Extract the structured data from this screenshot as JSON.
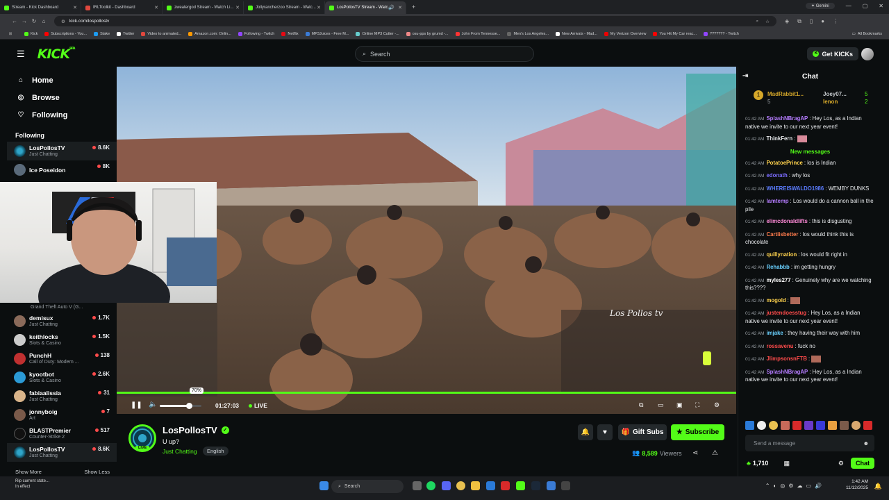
{
  "browser": {
    "tabs": [
      {
        "title": "Stream - Kick Dashboard",
        "active": false
      },
      {
        "title": "IRLToolkit - Dashboard",
        "active": false
      },
      {
        "title": "zweatergod Stream - Watch Li...",
        "active": false
      },
      {
        "title": "Jollyrancherzoo Stream - Watc...",
        "active": false
      },
      {
        "title": "LosPollosTV Stream - Watc...",
        "active": true
      }
    ],
    "gemini_label": "Gemini",
    "url": "kick.com/lospollostv",
    "bookmarks": [
      "Kick",
      "Subscriptions - You...",
      "Stake",
      "Twitter",
      "Video to animated...",
      "Amazon.com: Onlin...",
      "Following - Twitch",
      "Netflix",
      "MP3Juices - Free M...",
      "Online MP3 Cutter -...",
      "osu-pps by grumd -...",
      "John From Tennesse...",
      "Men's Los Angeles...",
      "New Arrivals - Mad...",
      "My Verizon Overview",
      "You Hit My Car reac...",
      "??????? - Twitch"
    ],
    "all_bookmarks": "All Bookmarks"
  },
  "header": {
    "logo": "KICK",
    "logo_badge": "BETA",
    "search_placeholder": "Search",
    "get_kicks": "Get KICKs"
  },
  "sidebar": {
    "nav": [
      {
        "label": "Home",
        "icon": "home-icon"
      },
      {
        "label": "Browse",
        "icon": "compass-icon"
      },
      {
        "label": "Following",
        "icon": "heart-icon"
      }
    ],
    "following_heading": "Following",
    "channels_top": [
      {
        "name": "LosPollosTV",
        "category": "Just Chatting",
        "viewers": "8.6K",
        "selected": true
      },
      {
        "name": "Ice Poseidon",
        "category": "",
        "viewers": "8K",
        "selected": false
      }
    ],
    "channels": [
      {
        "name": "demisux",
        "category": "Just Chatting",
        "viewers": "1.7K"
      },
      {
        "name": "keithlocks",
        "category": "Slots & Casino",
        "viewers": "1.5K"
      },
      {
        "name": "PunchH",
        "category": "Call of Duty: Modern ...",
        "viewers": "138"
      },
      {
        "name": "kyootbot",
        "category": "Slots & Casino",
        "viewers": "2.6K"
      },
      {
        "name": "fabiaalissia",
        "category": "Just Chatting",
        "viewers": "31"
      },
      {
        "name": "jonnyboig",
        "category": "Art",
        "viewers": "7"
      },
      {
        "name": "BLASTPremier",
        "category": "Counter-Strike 2",
        "viewers": "517"
      },
      {
        "name": "LosPollosTV",
        "category": "Just Chatting",
        "viewers": "8.6K"
      }
    ],
    "hidden_category": "Grand Theft Auto V (G...",
    "show_more": "Show More",
    "show_less": "Show Less"
  },
  "player": {
    "volume_percent": 70,
    "volume_label": "70%",
    "time": "01:27:03",
    "live_label": "LIVE",
    "watermark": "Los Pollos tv",
    "progress_fraction": 1.0
  },
  "stream": {
    "channel": "LosPollosTV",
    "live_badge": "LIVE",
    "title": "U up?",
    "category": "Just Chatting",
    "language": "English",
    "gift_subs": "Gift Subs",
    "subscribe": "Subscribe",
    "viewers": "8,589",
    "viewers_label": "Viewers"
  },
  "chat": {
    "title": "Chat",
    "pinned": [
      {
        "name": "MadRabbit1...",
        "count": "5"
      },
      {
        "name": "Joey07...",
        "count": "5"
      },
      {
        "name": "lenon",
        "count": "2"
      }
    ],
    "messages_before": [
      {
        "time": "01:42 AM",
        "user": "SplashNBragAP",
        "color": "#b57cff",
        "text": "Hey Los, as a Indian native we invite to our next year event!"
      },
      {
        "time": "01:42 AM",
        "user": "ThinkFern",
        "color": "#e8eaed",
        "text": ""
      }
    ],
    "new_messages": "New messages",
    "messages": [
      {
        "time": "01:42 AM",
        "user": "PotatoePrince",
        "color": "#ffd24d",
        "text": "los is Indian"
      },
      {
        "time": "01:42 AM",
        "user": "edonath",
        "color": "#7b6cff",
        "text": "why los"
      },
      {
        "time": "01:42 AM",
        "user": "WHEREISWALDO1986",
        "color": "#5b7cff",
        "text": "WEMBY DUNKS"
      },
      {
        "time": "01:42 AM",
        "user": "lamtemp",
        "color": "#b57cff",
        "text": "Los would do a cannon ball in the pile"
      },
      {
        "time": "01:42 AM",
        "user": "elimcdonaldlifts",
        "color": "#ff8ad8",
        "text": "this is disgusting"
      },
      {
        "time": "01:42 AM",
        "user": "Cartiisbetter",
        "color": "#ff7c4d",
        "text": "los would think this is chocolate"
      },
      {
        "time": "01:42 AM",
        "user": "quillynation",
        "color": "#ffd24d",
        "text": "los would fit right in"
      },
      {
        "time": "01:42 AM",
        "user": "Rehabbb",
        "color": "#6ad1ff",
        "text": "im getting hungry"
      },
      {
        "time": "01:42 AM",
        "user": "myles277",
        "color": "#ffffff",
        "text": "Genuinely why are we watching this????"
      },
      {
        "time": "01:42 AM",
        "user": "mogold",
        "color": "#ffd24d",
        "text": ""
      },
      {
        "time": "01:42 AM",
        "user": "justendoesstug",
        "color": "#ff4b4b",
        "text": "Hey Los, as a Indian native we invite to our next year event!"
      },
      {
        "time": "01:42 AM",
        "user": "imjake",
        "color": "#6ad1ff",
        "text": "they having their way with him"
      },
      {
        "time": "01:42 AM",
        "user": "rossavenu",
        "color": "#ff4b4b",
        "text": "fuck no"
      },
      {
        "time": "01:42 AM",
        "user": "JlimpsonsnFTB",
        "color": "#ff4b4b",
        "text": ""
      },
      {
        "time": "01:42 AM",
        "user": "SplashNBragAP",
        "color": "#b57cff",
        "text": "Hey Los, as a Indian native we invite to our next year event!"
      }
    ],
    "input_placeholder": "Send a message",
    "kicks_count": "1,710",
    "chat_button": "Chat"
  },
  "taskbar": {
    "notice_line1": "Rip current state...",
    "notice_line2": "In effect",
    "search": "Search",
    "time": "1:42 AM",
    "date": "11/12/2025"
  }
}
